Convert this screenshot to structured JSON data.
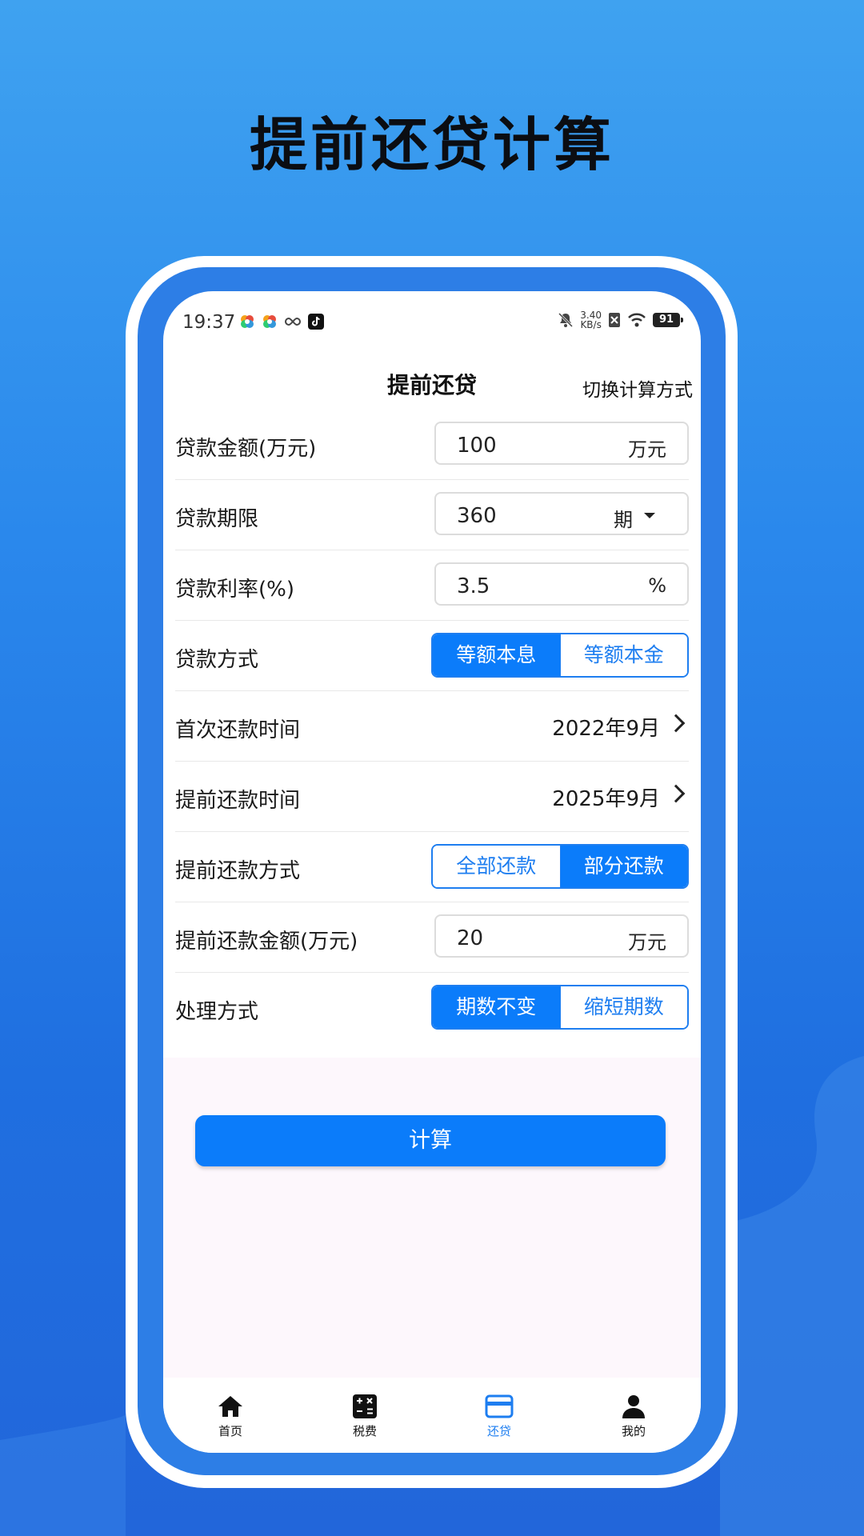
{
  "promo": {
    "title": "提前还贷计算"
  },
  "status_bar": {
    "time": "19:37",
    "net_speed_value": "3.40",
    "net_speed_unit": "KB/s",
    "battery": "91"
  },
  "header": {
    "title": "提前还贷",
    "action": "切换计算方式"
  },
  "form": {
    "loan_amount": {
      "label": "贷款金额(万元)",
      "value": "100",
      "unit": "万元"
    },
    "loan_term": {
      "label": "贷款期限",
      "value": "360",
      "unit": "期"
    },
    "loan_rate": {
      "label": "贷款利率(%)",
      "value": "3.5",
      "unit": "%"
    },
    "loan_method": {
      "label": "贷款方式",
      "options": [
        "等额本息",
        "等额本金"
      ],
      "selected": "等额本息"
    },
    "first_payment": {
      "label": "首次还款时间",
      "value": "2022年9月"
    },
    "prepay_time": {
      "label": "提前还款时间",
      "value": "2025年9月"
    },
    "prepay_method": {
      "label": "提前还款方式",
      "options": [
        "全部还款",
        "部分还款"
      ],
      "selected": "部分还款"
    },
    "prepay_amount": {
      "label": "提前还款金额(万元)",
      "value": "20",
      "unit": "万元"
    },
    "handling": {
      "label": "处理方式",
      "options": [
        "期数不变",
        "缩短期数"
      ],
      "selected": "期数不变"
    }
  },
  "calc_button": "计算",
  "nav": [
    {
      "label": "首页",
      "icon": "home-icon"
    },
    {
      "label": "税费",
      "icon": "calculator-icon"
    },
    {
      "label": "还贷",
      "icon": "card-icon",
      "active": true
    },
    {
      "label": "我的",
      "icon": "person-icon"
    }
  ],
  "colors": {
    "accent": "#0b7cfa",
    "background_top": "#3fa2f0",
    "background_bottom": "#2266da"
  }
}
